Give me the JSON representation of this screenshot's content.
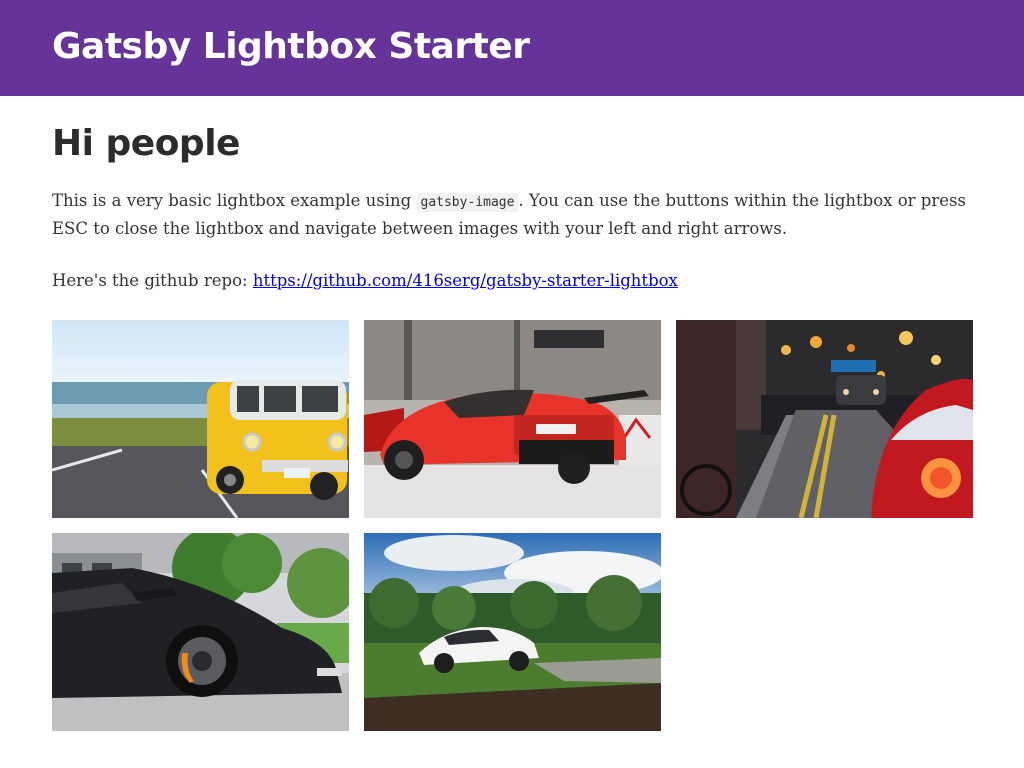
{
  "header": {
    "title": "Gatsby Lightbox Starter",
    "background_color": "#663399"
  },
  "main": {
    "heading": "Hi people",
    "intro": {
      "before": "This is a very basic lightbox example using ",
      "code": "gatsby-image",
      "after": ". You can use the buttons within the lightbox or press ESC to close the lightbox and navigate between images with your left and right arrows."
    },
    "repo": {
      "label": "Here's the github repo: ",
      "link_text": "https://github.com/416serg/gatsby-starter-lightbox",
      "href": "https://github.com/416serg/gatsby-starter-lightbox"
    }
  },
  "gallery": {
    "images": [
      {
        "subject": "yellow-vw-bus-by-sea"
      },
      {
        "subject": "red-ferrari-in-garage"
      },
      {
        "subject": "red-car-on-night-street"
      },
      {
        "subject": "black-lamborghini"
      },
      {
        "subject": "white-tesla-in-field"
      }
    ]
  }
}
